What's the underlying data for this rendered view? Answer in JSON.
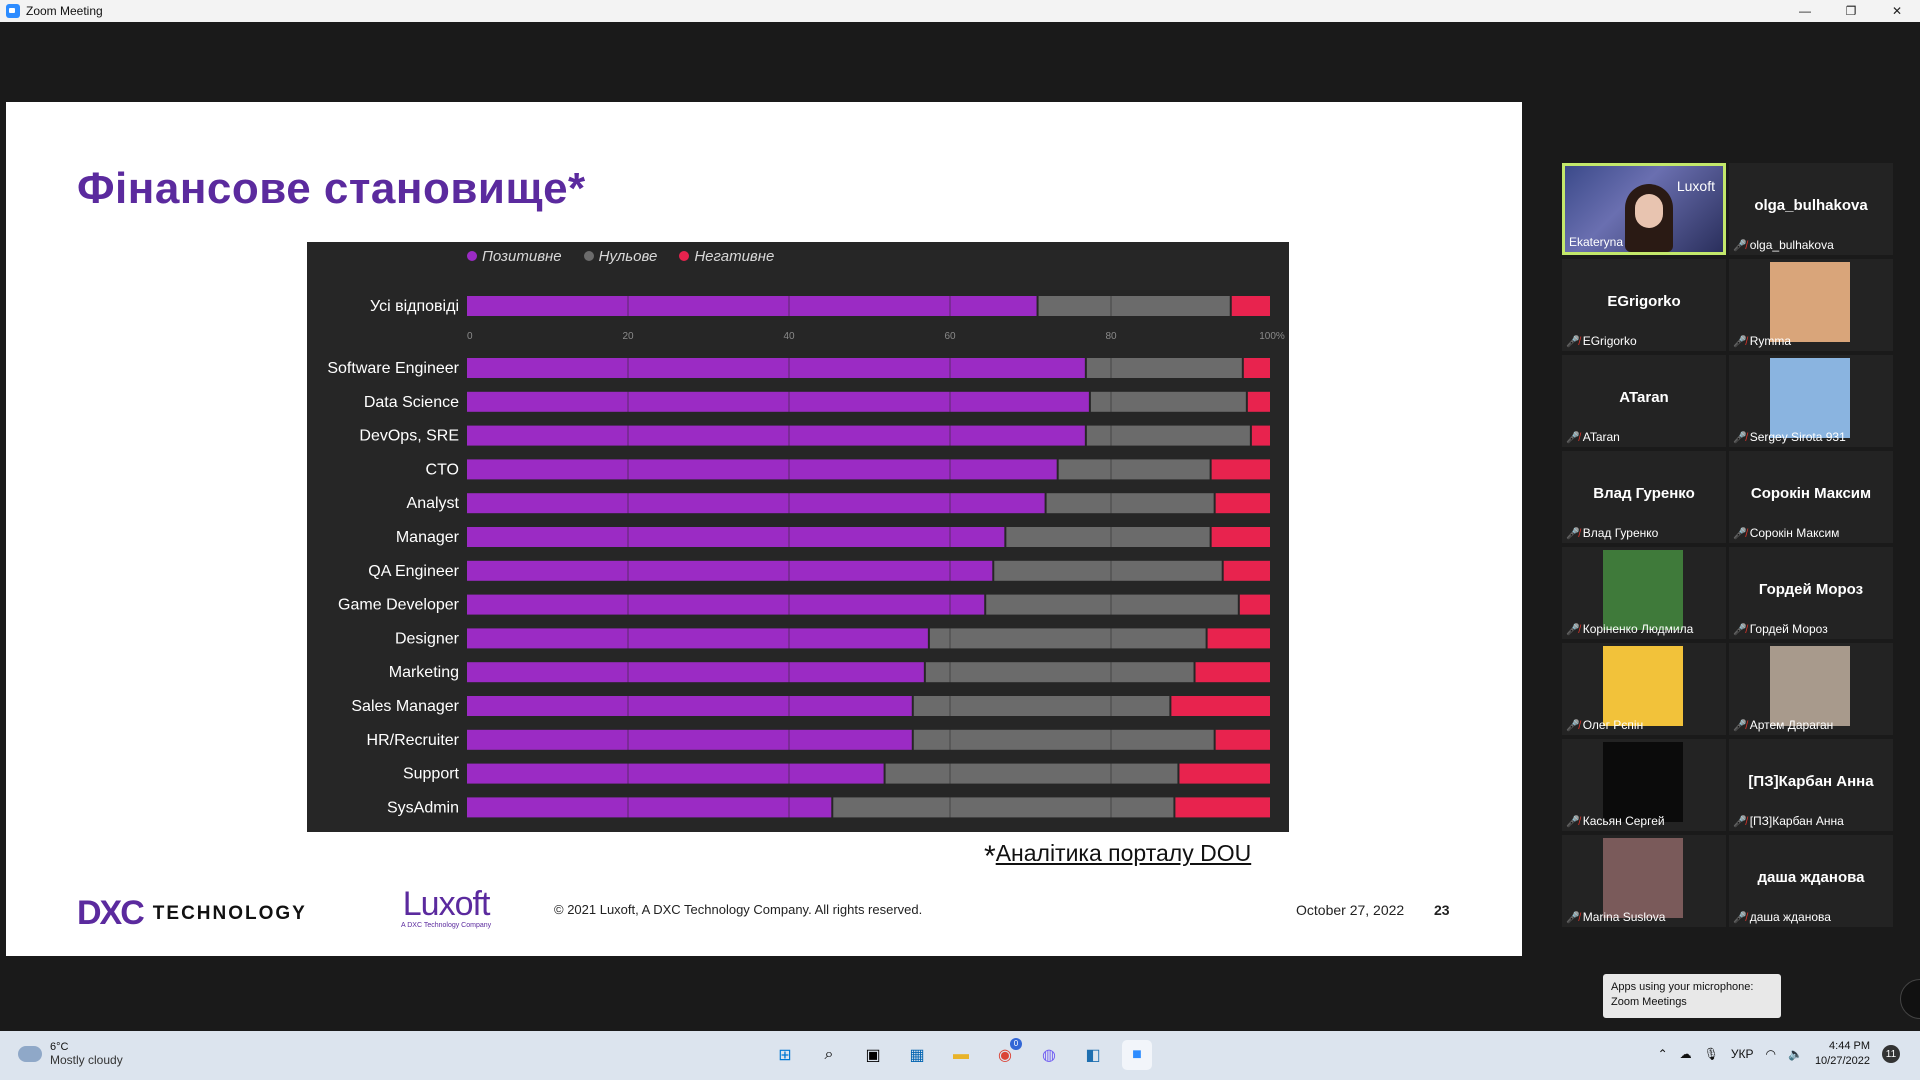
{
  "window": {
    "title": "Zoom Meeting",
    "minimize": "—",
    "restore": "❐",
    "close": "✕"
  },
  "slide": {
    "title": "Фінансове становище*",
    "footnote_star": "*",
    "footnote_link": "Аналітика порталу DOU",
    "dxc_mark": "DXC",
    "dxc_text": "TECHNOLOGY",
    "luxoft_word": "Luxoft",
    "luxoft_sub": "A DXC Technology Company",
    "copyright": "© 2021 Luxoft, A DXC Technology Company. All rights reserved.",
    "date": "October 27, 2022",
    "page_number": "23"
  },
  "chart_data": {
    "type": "bar",
    "orientation": "horizontal-stacked",
    "legend_position": "top",
    "legend": [
      {
        "name": "Позитивне",
        "color": "#9b2bc4"
      },
      {
        "name": "Нульове",
        "color": "#6b6b6b"
      },
      {
        "name": "Негативне",
        "color": "#e8234e"
      }
    ],
    "xlim": [
      0,
      100
    ],
    "x_ticks": [
      "0",
      "20",
      "40",
      "60",
      "80",
      "100%"
    ],
    "summary": {
      "category": "Усі відповіді",
      "values": [
        71,
        24,
        5
      ]
    },
    "categories": [
      "Software Engineer",
      "Data Science",
      "DevOps, SRE",
      "CTO",
      "Analyst",
      "Manager",
      "QA Engineer",
      "Game Developer",
      "Designer",
      "Marketing",
      "Sales Manager",
      "HR/Recruiter",
      "Support",
      "SysAdmin"
    ],
    "series": [
      {
        "name": "Позитивне",
        "values": [
          77,
          77.5,
          77,
          73.5,
          72,
          67,
          65.5,
          64.5,
          57.5,
          57,
          55.5,
          55.5,
          52,
          45.5
        ]
      },
      {
        "name": "Нульове",
        "values": [
          19.5,
          19.5,
          20.5,
          19,
          21,
          25.5,
          28.5,
          31.5,
          34.5,
          33.5,
          32,
          37.5,
          36.5,
          42.5
        ]
      },
      {
        "name": "Негативне",
        "values": [
          3.5,
          3,
          2.5,
          7.5,
          7,
          7.5,
          6,
          4,
          8,
          9.5,
          12.5,
          7,
          11.5,
          12
        ]
      }
    ]
  },
  "participants": [
    {
      "big": "",
      "name": "Ekateryna",
      "video": true,
      "logo": "Luxoft"
    },
    {
      "big": "olga_bulhakova",
      "name": "olga_bulhakova"
    },
    {
      "big": "EGrigorko",
      "name": "EGrigorko"
    },
    {
      "big": "",
      "name": "Rymma",
      "thumb": "#d9a57a"
    },
    {
      "big": "ATaran",
      "name": "ATaran"
    },
    {
      "big": "",
      "name": "Sergey Sirota 931",
      "thumb": "#8ab4e0"
    },
    {
      "big": "Влад Гуренко",
      "name": "Влад Гуренко"
    },
    {
      "big": "Сорокін Максим",
      "name": "Сорокін Максим"
    },
    {
      "big": "",
      "name": "Коріненко Людмила",
      "thumb": "#3f7a3a"
    },
    {
      "big": "Гордей Мороз",
      "name": "Гордей Мороз"
    },
    {
      "big": "",
      "name": "Олег Рєпін",
      "thumb": "#f2c23a"
    },
    {
      "big": "",
      "name": "Артем Дараган",
      "thumb": "#a89a8c"
    },
    {
      "big": "",
      "name": "Касьян Сергей",
      "thumb": "#0b0b0b"
    },
    {
      "big": "[ПЗ]Карбан Анна",
      "name": "[ПЗ]Карбан Анна"
    },
    {
      "big": "",
      "name": "Marina Suslova",
      "thumb": "#7a5a5a"
    },
    {
      "big": "даша жданова",
      "name": "даша жданова"
    }
  ],
  "tooltip": {
    "line1": "Apps using your microphone:",
    "line2": "Zoom Meetings"
  },
  "taskbar": {
    "temp": "6°C",
    "condition": "Mostly cloudy",
    "language": "УКР",
    "time": "4:44 PM",
    "date": "10/27/2022",
    "notifications": "11",
    "chrome_badge": "0"
  }
}
